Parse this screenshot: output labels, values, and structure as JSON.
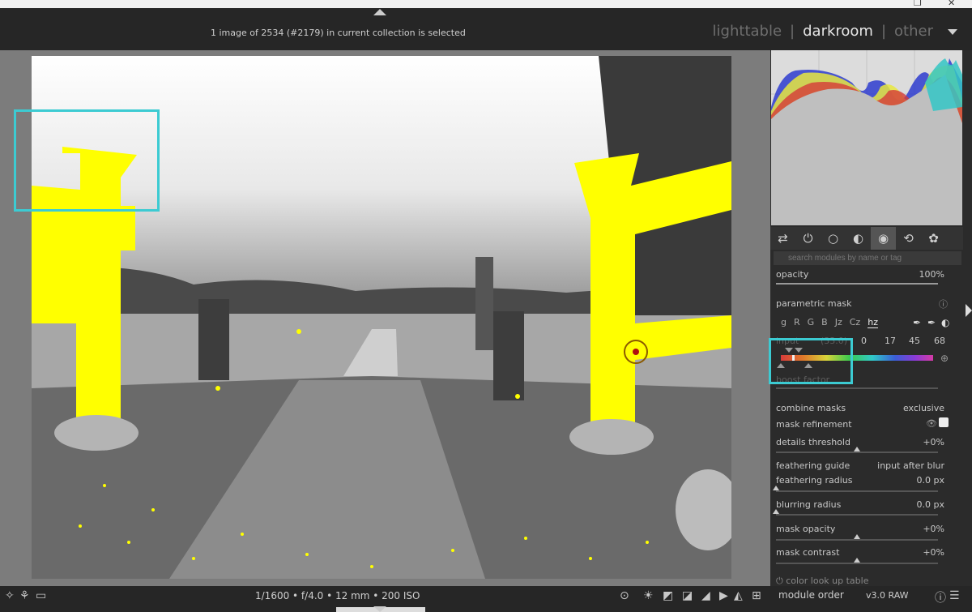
{
  "header": {
    "collection_status": "1 image of 2534 (#2179) in current collection is selected",
    "views": [
      "lighttable",
      "darkroom",
      "other"
    ],
    "separator": "|"
  },
  "window": {
    "close": "✕",
    "restore": "❐"
  },
  "module_groups": [
    "⇄",
    "⏻",
    "○",
    "◐",
    "◉",
    "⟲",
    "✿"
  ],
  "search": {
    "placeholder": "search modules by name or tag"
  },
  "opacity": {
    "label": "opacity",
    "value": "100%",
    "level": 1.0
  },
  "parametric_mask": {
    "title": "parametric mask",
    "channels": [
      "g",
      "R",
      "G",
      "B",
      "Jz",
      "Cz",
      "hz"
    ],
    "active_channel": "hz",
    "input_label": "input",
    "input_value": "(33.0)",
    "ticks": [
      "0",
      "17",
      "45",
      "68"
    ],
    "boost_label": "boost factor"
  },
  "mask_options": {
    "combine_masks": {
      "label": "combine masks",
      "value": "exclusive"
    },
    "mask_refinement": {
      "label": "mask refinement"
    },
    "details_threshold": {
      "label": "details threshold",
      "value": "+0%",
      "level": 0.5
    },
    "feathering_guide": {
      "label": "feathering guide",
      "value": "input after blur"
    },
    "feathering_radius": {
      "label": "feathering radius",
      "value": "0.0 px",
      "level": 0.0
    },
    "blurring_radius": {
      "label": "blurring radius",
      "value": "0.0 px",
      "level": 0.0
    },
    "mask_opacity": {
      "label": "mask opacity",
      "value": "+0%",
      "level": 0.5
    },
    "mask_contrast": {
      "label": "mask contrast",
      "value": "+0%",
      "level": 0.5
    }
  },
  "next_module": {
    "label": "color look up table"
  },
  "bottom": {
    "exif": "1/1600 • f/4.0 • 12 mm • 200 ISO",
    "module_order_label": "module order",
    "module_order_value": "v3.0 RAW"
  },
  "colors": {
    "accent": "#3ccbd2",
    "mask": "#ffff00",
    "panel": "#2b2b2b"
  }
}
